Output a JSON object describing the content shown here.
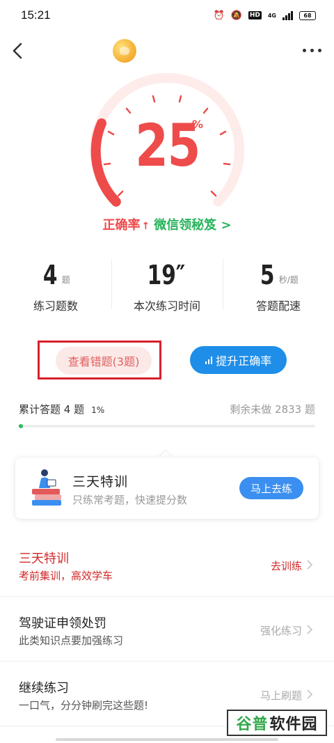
{
  "status": {
    "time": "15:21",
    "network": "4G",
    "hd": "HD",
    "battery": "68"
  },
  "gauge": {
    "value": "25",
    "unit": "%"
  },
  "accuracy": {
    "label": "正确率",
    "arrow": "↑",
    "link": "微信领秘笈 >"
  },
  "stats": [
    {
      "value": "4",
      "unit": "题",
      "label": "练习题数"
    },
    {
      "value": "19″",
      "unit": "",
      "label": "本次练习时间"
    },
    {
      "value": "5",
      "unit": "秒/题",
      "label": "答题配速"
    }
  ],
  "buttons": {
    "wrong": "查看错题(3题)",
    "boost": "提升正确率"
  },
  "progress": {
    "left": "累计答题 4 题",
    "percent": "1%",
    "right": "剩余未做 2833 题",
    "fraction": 0.01
  },
  "promo": {
    "title": "三天特训",
    "subtitle": "只练常考题，快速提分数",
    "button": "马上去练"
  },
  "list": [
    {
      "title": "三天特训",
      "subtitle": "考前集训，高效学车",
      "action": "去训练"
    },
    {
      "title": "驾驶证申领处罚",
      "subtitle": "此类知识点要加强练习",
      "action": "强化练习"
    },
    {
      "title": "继续练习",
      "subtitle": "一口气，分分钟刷完这些题!",
      "action": "马上刷题"
    }
  ],
  "watermark": {
    "part1": "谷普",
    "part2": "软件园"
  },
  "colors": {
    "accent_red": "#ee4b4b",
    "accent_green": "#27b35c",
    "accent_blue": "#1e8ee8",
    "highlight_box": "#d8202c"
  }
}
